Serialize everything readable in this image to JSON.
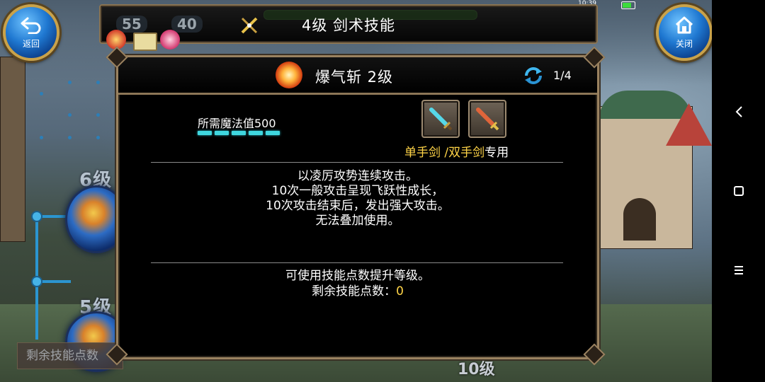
{
  "status_bar": {
    "time": "10:39"
  },
  "top_bar": {
    "title": "4级 剑术技能",
    "stat_left": "55",
    "stat_right": "40",
    "back_label": "返回",
    "close_label": "关闭"
  },
  "background": {
    "level6": "6级",
    "level5": "5级",
    "level10": "10级",
    "remaining_points_label": "剩余技能点数"
  },
  "dialog": {
    "skill_name": "爆气斩 2级",
    "page_indicator": "1/4",
    "mana_required": "所需魔法值500",
    "mana_segments": 5,
    "weapon_caption_yellow": "单手剑 /双手剑",
    "weapon_caption_white": "专用",
    "description": [
      "以凌厉攻势连续攻击。",
      "10次一般攻击呈现飞跃性成长，",
      "10次攻击结束后，发出强大攻击。",
      "无法叠加使用。"
    ],
    "upgrade_hint": "可使用技能点数提升等级。",
    "remaining_label": "剩余技能点数：",
    "remaining_value": "0"
  },
  "colors": {
    "frame_gold": "#9a8260",
    "mana_cyan": "#3fd7df",
    "highlight_yellow": "#ffd447",
    "button_blue": "#1f78d1"
  },
  "icons": {
    "back": "back-arrow-icon",
    "close": "home-icon",
    "skill": "burst-slash-icon",
    "refresh": "refresh-icon",
    "one_hand_sword": "one-handed-sword-icon",
    "two_hand_sword": "two-handed-sword-icon"
  }
}
